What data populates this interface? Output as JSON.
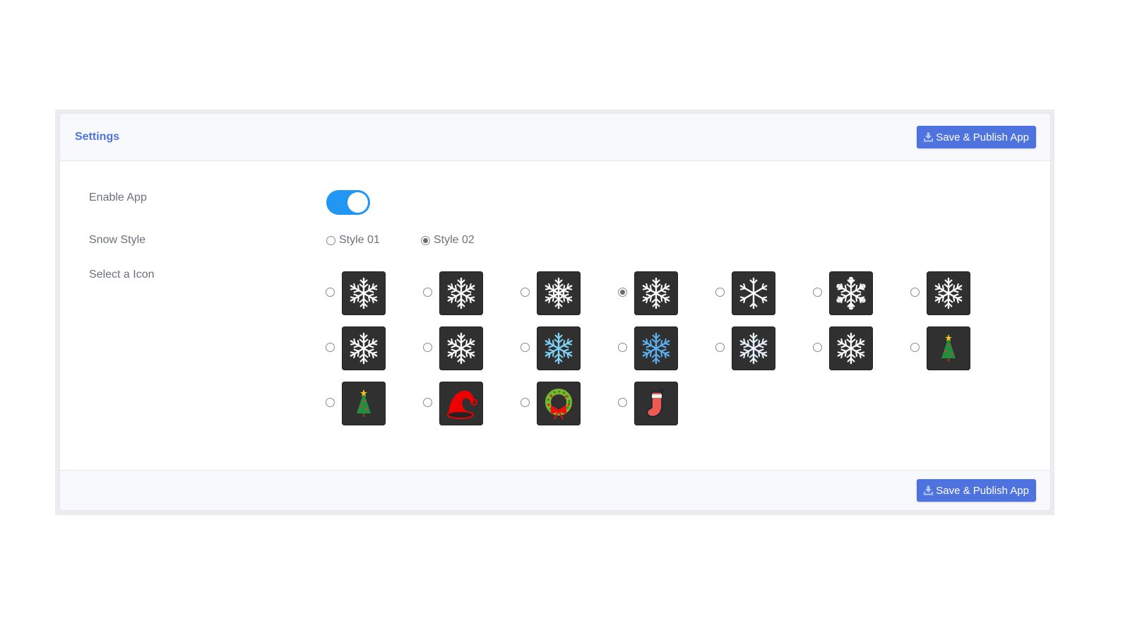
{
  "card": {
    "title": "Settings",
    "save_button_label": "Save & Publish App",
    "save_button_icon": "download-icon"
  },
  "colors": {
    "primary": "#4e73df",
    "toggle_on": "#2196f3",
    "tile_bg": "#303030"
  },
  "settings": {
    "enable_app": {
      "label": "Enable App",
      "enabled": true
    },
    "snow_style": {
      "label": "Snow Style",
      "options": [
        {
          "label": "Style 01",
          "checked": false
        },
        {
          "label": "Style 02",
          "checked": true
        }
      ]
    },
    "select_icon": {
      "label": "Select a Icon",
      "selected_index": 3,
      "icons": [
        "snowflake-fern-icon",
        "snowflake-star-icon",
        "snowflake-ring-icon",
        "snowflake-star-outline-icon",
        "snowflake-simple-icon",
        "snowflake-dotted-icon",
        "snowflake-hexagon-icon",
        "snowflake-ornate-icon",
        "snowflake-ornate-2-icon",
        "snowflake-crystal-icon",
        "snowflake-blue-icon",
        "snowflake-lightblue-icon",
        "snowflake-white-glow-icon",
        "christmas-tree-small-icon",
        "christmas-tree-icon",
        "santa-hat-icon",
        "wreath-icon",
        "stocking-icon"
      ]
    }
  }
}
